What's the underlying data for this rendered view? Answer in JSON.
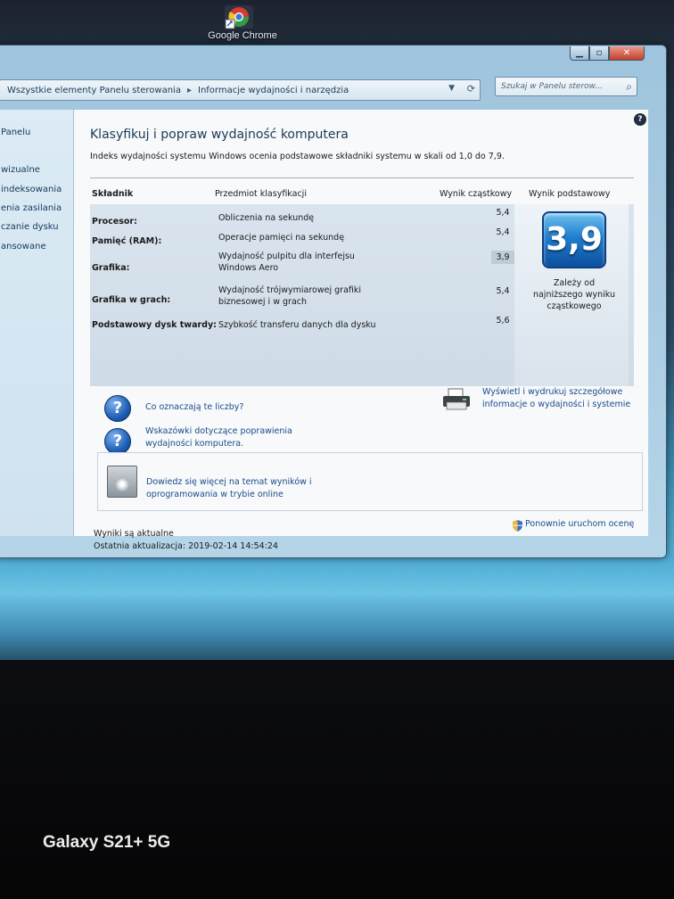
{
  "desktop": {
    "icons": [
      {
        "label": "Google Chrome",
        "icon": "chrome-icon"
      }
    ]
  },
  "window": {
    "controls": {
      "minimize": "▁",
      "maximize": "▫",
      "close": "✕"
    },
    "address": {
      "segments": [
        "Wszystkie elementy Panelu sterowania",
        "Informacje wydajności i narzędzia"
      ],
      "separator": "▸"
    },
    "search": {
      "placeholder": "Szukaj w Panelu sterow...",
      "icon": "search-icon"
    },
    "sidebar": {
      "items": [
        "Panelu",
        "wizualne",
        "indeksowania",
        "enia zasilania",
        "czanie dysku",
        "ansowane"
      ]
    },
    "main": {
      "title": "Klasyfikuj i popraw wydajność komputera",
      "subtitle": "Indeks wydajności systemu Windows ocenia podstawowe składniki systemu w skali od 1,0 do 7,9.",
      "table": {
        "headers": [
          "Składnik",
          "Przedmiot klasyfikacji",
          "Wynik cząstkowy",
          "Wynik podstawowy"
        ],
        "rows": [
          {
            "component": "Procesor:",
            "description": "Obliczenia na sekundę",
            "score": "5,4"
          },
          {
            "component": "Pamięć (RAM):",
            "description": "Operacje pamięci na sekundę",
            "score": "5,4"
          },
          {
            "component": "Grafika:",
            "description": "Wydajność pulpitu dla interfejsu Windows Aero",
            "score": "3,9"
          },
          {
            "component": "Grafika w grach:",
            "description": "Wydajność trójwymiarowej grafiki biznesowej i w grach",
            "score": "5,4"
          },
          {
            "component": "Podstawowy dysk twardy:",
            "description": "Szybkość transferu danych dla dysku",
            "score": "5,6"
          }
        ],
        "base_score": "3,9",
        "base_note": "Zależy od najniższego wyniku cząstkowego"
      },
      "links": {
        "what_numbers": "Co oznaczają te liczby?",
        "tips": "Wskazówki dotyczące poprawienia wydajności komputera.",
        "print": "Wyświetl i wydrukuj szczegółowe informacje o wydajności i systemie",
        "online": "Dowiedz się więcej na temat wyników i oprogramowania w trybie online",
        "rerate": "Ponownie uruchom ocenę"
      },
      "status": {
        "current": "Wyniki są aktualne",
        "last_update": "Ostatnia aktualizacja: 2019-02-14 14:54:24"
      }
    }
  },
  "photo": {
    "watermark": "Galaxy S21+ 5G"
  },
  "colors": {
    "link": "#1a4b8a",
    "badge_blue": "#1f7fcf",
    "window_frame": "#9fc4dd"
  }
}
